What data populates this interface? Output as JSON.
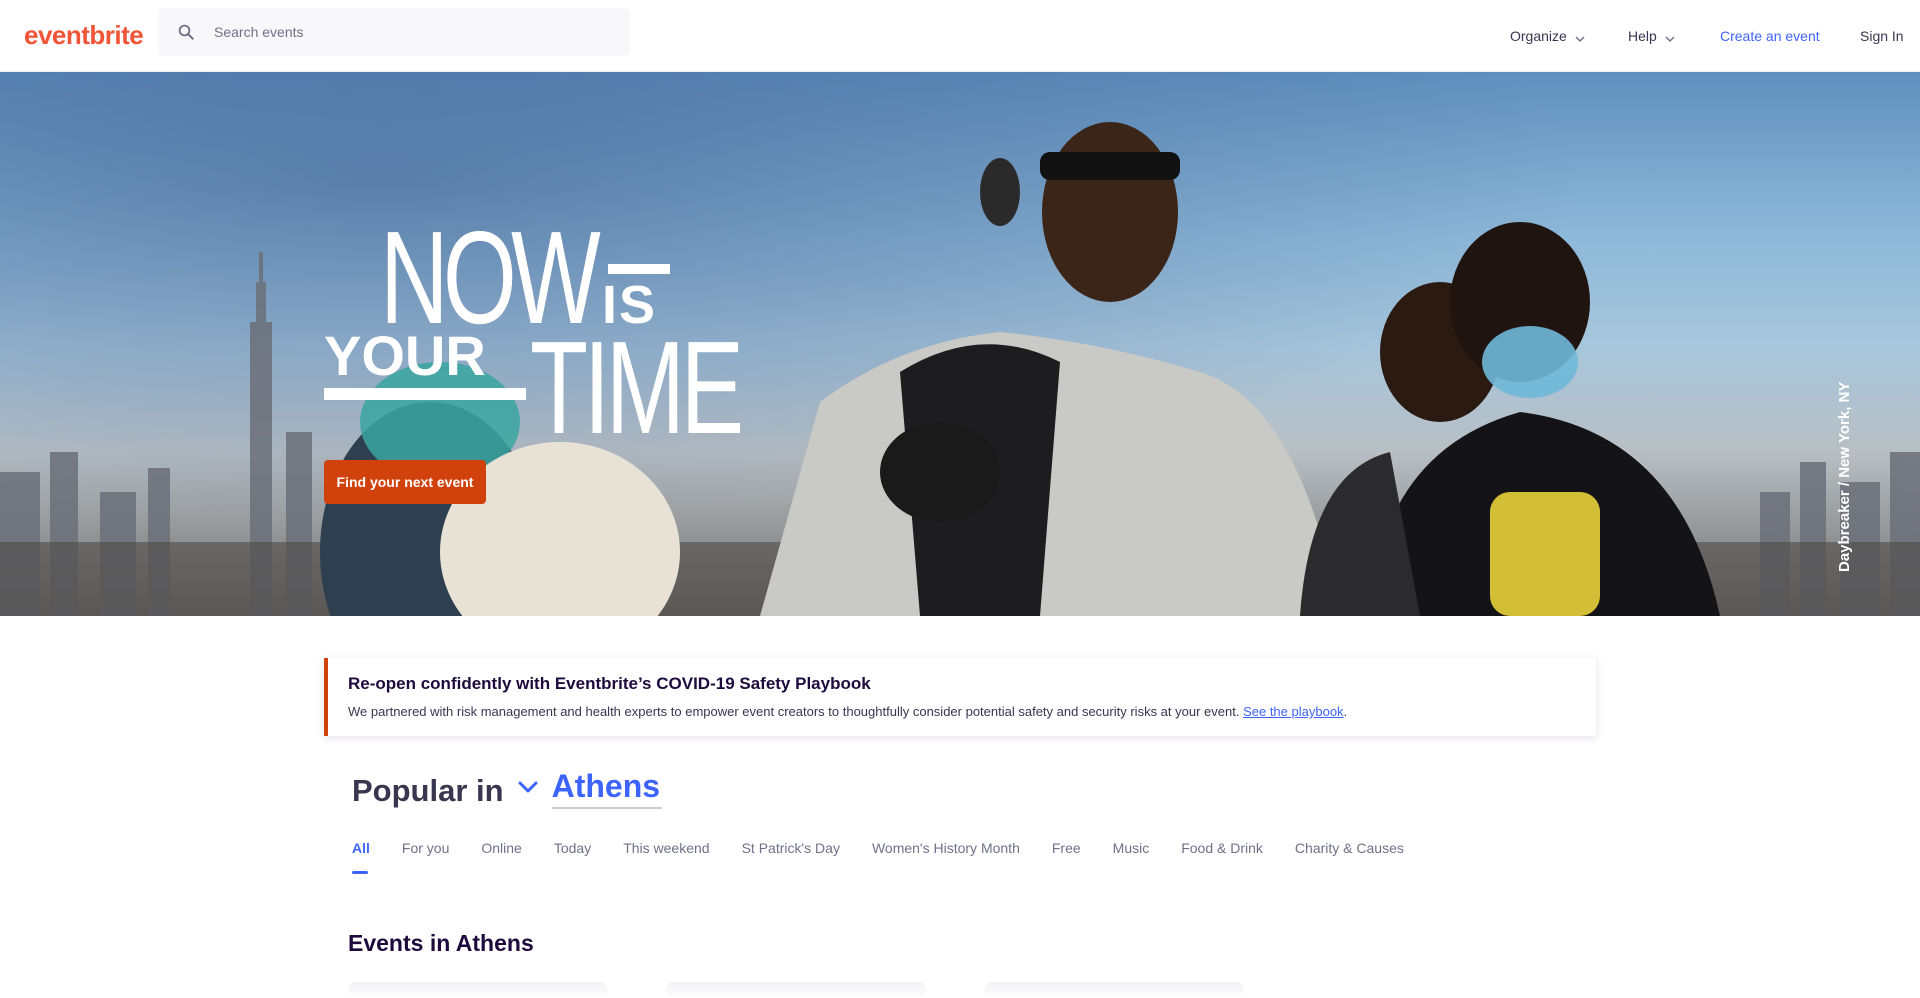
{
  "header": {
    "logo": "eventbrite",
    "search_placeholder": "Search events",
    "nav": {
      "organize": "Organize",
      "help": "Help",
      "create_event": "Create an event",
      "sign_in": "Sign In"
    }
  },
  "hero": {
    "headline": {
      "now": "NOW",
      "is": "IS",
      "your": "YOUR",
      "time": "TIME"
    },
    "cta": "Find your next event",
    "credit": "Daybreaker / New York, NY"
  },
  "covid_banner": {
    "title": "Re-open confidently with Eventbrite’s COVID-19 Safety Playbook",
    "body": "We partnered with risk management and health experts to empower event creators to thoughtfully consider potential safety and security risks at your event.",
    "link": "See the playbook",
    "after_link": "."
  },
  "popular": {
    "label": "Popular in",
    "city": "Athens"
  },
  "tabs": [
    "All",
    "For you",
    "Online",
    "Today",
    "This weekend",
    "St Patrick's Day",
    "Women's History Month",
    "Free",
    "Music",
    "Food & Drink",
    "Charity & Causes"
  ],
  "active_tab": "All",
  "events_heading": "Events in Athens",
  "colors": {
    "brand": "#f05537",
    "cta": "#d1410c",
    "link": "#3d64ff",
    "text": "#1e0a3c"
  },
  "icons": [
    "search-icon",
    "chevron-down-icon"
  ]
}
